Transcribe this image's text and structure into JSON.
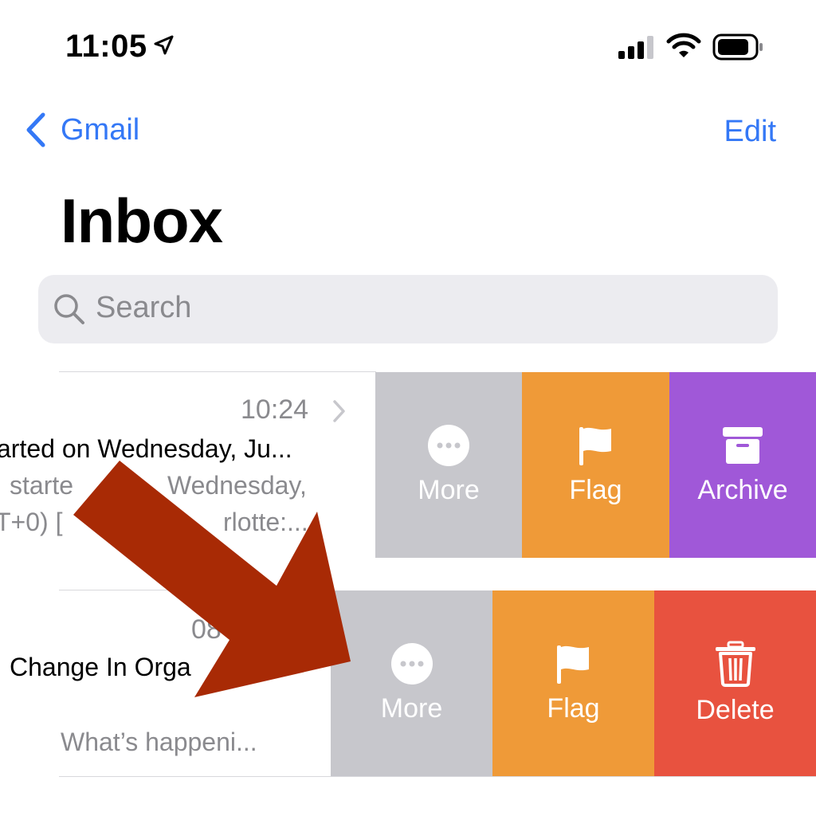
{
  "status_bar": {
    "time": "11:05"
  },
  "nav": {
    "back_label": "Gmail",
    "edit_label": "Edit"
  },
  "page": {
    "title": "Inbox"
  },
  "search": {
    "placeholder": "Search"
  },
  "emails": [
    {
      "time": "10:24",
      "subject": "arted on Wednesday, Ju...",
      "preview_line1": "starte",
      "preview_line1b": "Wednesday,",
      "preview_line2": "T+0) [",
      "preview_line2b": "rlotte:..."
    },
    {
      "time": "08",
      "subject": "Change In Orga",
      "preview": "What’s happeni..."
    }
  ],
  "actions_row1": [
    {
      "label": "More",
      "icon": "ellipsis-circle-icon",
      "color": "#c7c7cc"
    },
    {
      "label": "Flag",
      "icon": "flag-icon",
      "color": "#ef9a38"
    },
    {
      "label": "Archive",
      "icon": "archive-box-icon",
      "color": "#a058d8"
    }
  ],
  "actions_row2": [
    {
      "label": "More",
      "icon": "ellipsis-circle-icon",
      "color": "#c7c7cc"
    },
    {
      "label": "Flag",
      "icon": "flag-icon",
      "color": "#ef9a38"
    },
    {
      "label": "Delete",
      "icon": "trash-icon",
      "color": "#e8523f"
    }
  ],
  "colors": {
    "accent": "#3478f6",
    "overlay_arrow": "#a82a05"
  }
}
